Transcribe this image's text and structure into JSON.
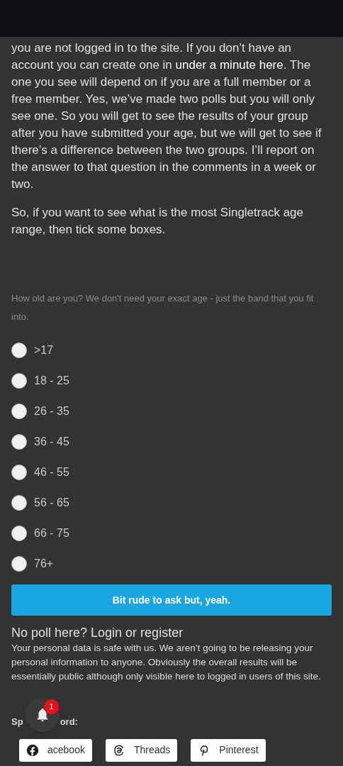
{
  "article": {
    "paragraph_1": {
      "before": "you are not logged in to the site. If you don’t have an account you can create one in",
      "link": "under a minute here",
      "after": ". The one you see will depend on if you are a full member or a free member. Yes, we’ve made two polls but you will only see one. So you will get to see the results of your group after you have submitted your age, but we will get to see if there’s a difference between the two groups. I’ll report on the answer to that question in the comments in a week or two."
    },
    "paragraph_2": "So, if you want to see what is the most Singletrack age range, then tick some boxes."
  },
  "poll": {
    "question": "How old are you? We don't need your exact age - just the band that you fit into.",
    "options": [
      {
        "label": ">17",
        "selected": false
      },
      {
        "label": "18 - 25",
        "selected": false
      },
      {
        "label": "26 - 35",
        "selected": false
      },
      {
        "label": "36 - 45",
        "selected": false
      },
      {
        "label": "46 - 55",
        "selected": false
      },
      {
        "label": "56 - 65",
        "selected": false
      },
      {
        "label": "66 - 75",
        "selected": false
      },
      {
        "label": "76+",
        "selected": false
      }
    ],
    "submit": "Bit rude to ask but, yeah."
  },
  "notice": {
    "heading": "No poll here? Login or register",
    "text": "Your personal data is safe with us. We aren’t going to be releasing your personal information to anyone. Obviously the overall results will be essentially public although only visible here to logged in users of this site."
  },
  "share": {
    "label_start": "Sp",
    "label_end": "ord:",
    "buttons": [
      {
        "kind": "facebook",
        "label": "acebook"
      },
      {
        "kind": "threads",
        "label": "Threads"
      },
      {
        "kind": "pinterest",
        "label": "Pinterest"
      }
    ]
  },
  "notifications": {
    "badge": "1"
  }
}
